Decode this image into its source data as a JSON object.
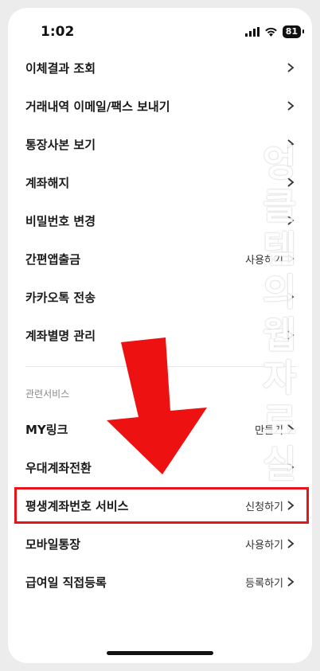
{
  "status": {
    "time": "1:02",
    "battery": "81"
  },
  "menu_items": [
    {
      "label": "이체결과 조회",
      "action": ""
    },
    {
      "label": "거래내역 이메일/팩스 보내기",
      "action": ""
    },
    {
      "label": "통장사본 보기",
      "action": ""
    },
    {
      "label": "계좌해지",
      "action": ""
    },
    {
      "label": "비밀번호 변경",
      "action": ""
    },
    {
      "label": "간편앱출금",
      "action": "사용하기"
    },
    {
      "label": "카카오톡 전송",
      "action": ""
    },
    {
      "label": "계좌별명 관리",
      "action": ""
    }
  ],
  "related_section": {
    "title": "관련서비스",
    "items": [
      {
        "label": "MY링크",
        "action": "만들기"
      },
      {
        "label": "우대계좌전환",
        "action": ""
      },
      {
        "label": "평생계좌번호 서비스",
        "action": "신청하기"
      },
      {
        "label": "모바일통장",
        "action": "사용하기"
      },
      {
        "label": "급여일 직접등록",
        "action": "등록하기"
      }
    ]
  },
  "watermark": "엉클템의 웹자료실",
  "colors": {
    "highlight": "#e8141c",
    "arrow": "#ee1111"
  },
  "icons": {
    "chevron": "chevron-right-icon",
    "arrow": "arrow-down-icon"
  }
}
